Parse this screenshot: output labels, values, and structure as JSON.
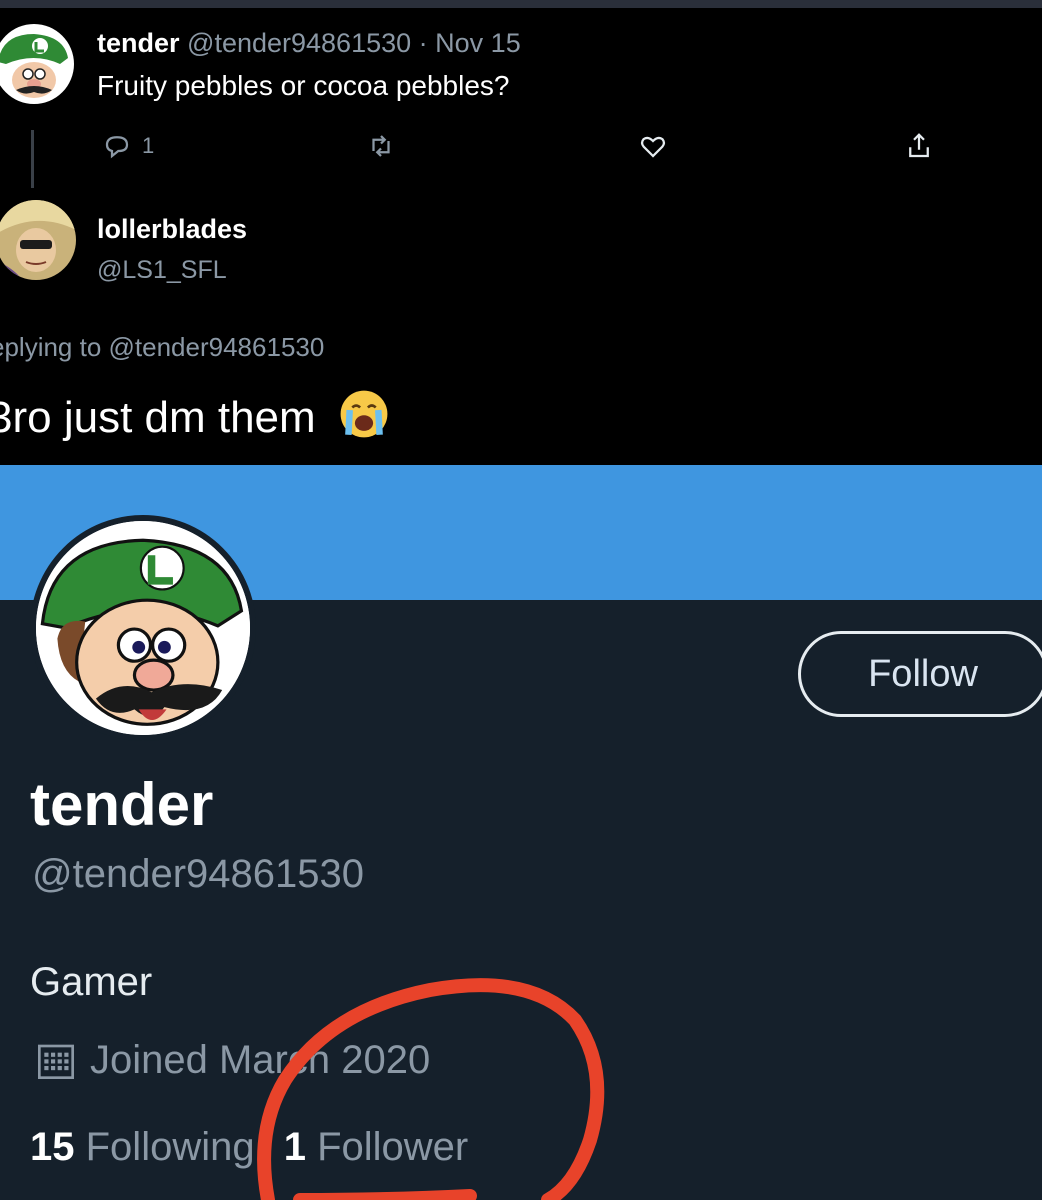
{
  "tweet": {
    "author_name": "tender",
    "author_handle": "@tender94861530",
    "date": "· Nov 15",
    "text": "Fruity pebbles or cocoa pebbles?",
    "reply_count": "1"
  },
  "reply": {
    "author_name": "lollerblades",
    "author_handle": "@LS1_SFL",
    "replying_to": "eplying to @tender94861530",
    "text": "3ro just dm them",
    "emoji": "loudly-crying-face-emoji"
  },
  "profile": {
    "display_name": "tender",
    "handle": "@tender94861530",
    "bio": "Gamer",
    "joined": "Joined March 2020",
    "following_count": "15",
    "following_label": "Following",
    "follower_count": "1",
    "follower_label": "Follower",
    "follow_button": "Follow"
  },
  "colors": {
    "banner": "#3f96e0",
    "profile_bg": "#15202b",
    "annotation": "#e8432a"
  },
  "icons": [
    "reply-icon",
    "retweet-icon",
    "like-icon",
    "share-icon",
    "calendar-icon"
  ]
}
